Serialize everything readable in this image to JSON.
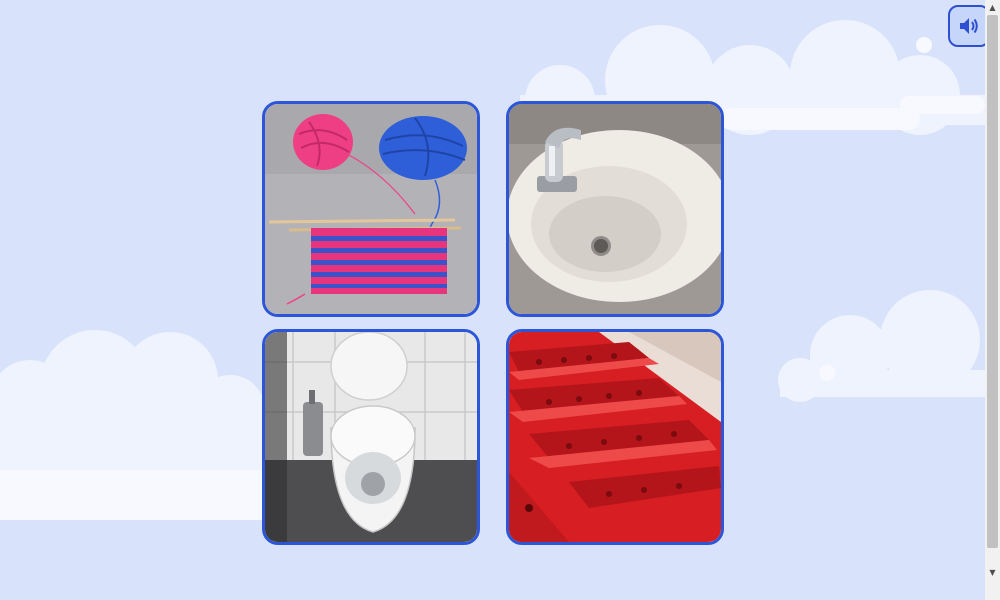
{
  "sound_button": {
    "icon": "speaker-icon"
  },
  "options": [
    {
      "id": "yarn",
      "icon": "yarn-knitting-image"
    },
    {
      "id": "sink",
      "icon": "sink-image"
    },
    {
      "id": "toilet",
      "icon": "toilet-image"
    },
    {
      "id": "stairs",
      "icon": "red-stairs-image"
    }
  ],
  "scrollbar": {
    "up_arrow": "▲",
    "down_arrow": "▼"
  },
  "colors": {
    "background": "#d8e3fb",
    "card_border": "#2d55d8",
    "cloud": "#ffffff"
  }
}
